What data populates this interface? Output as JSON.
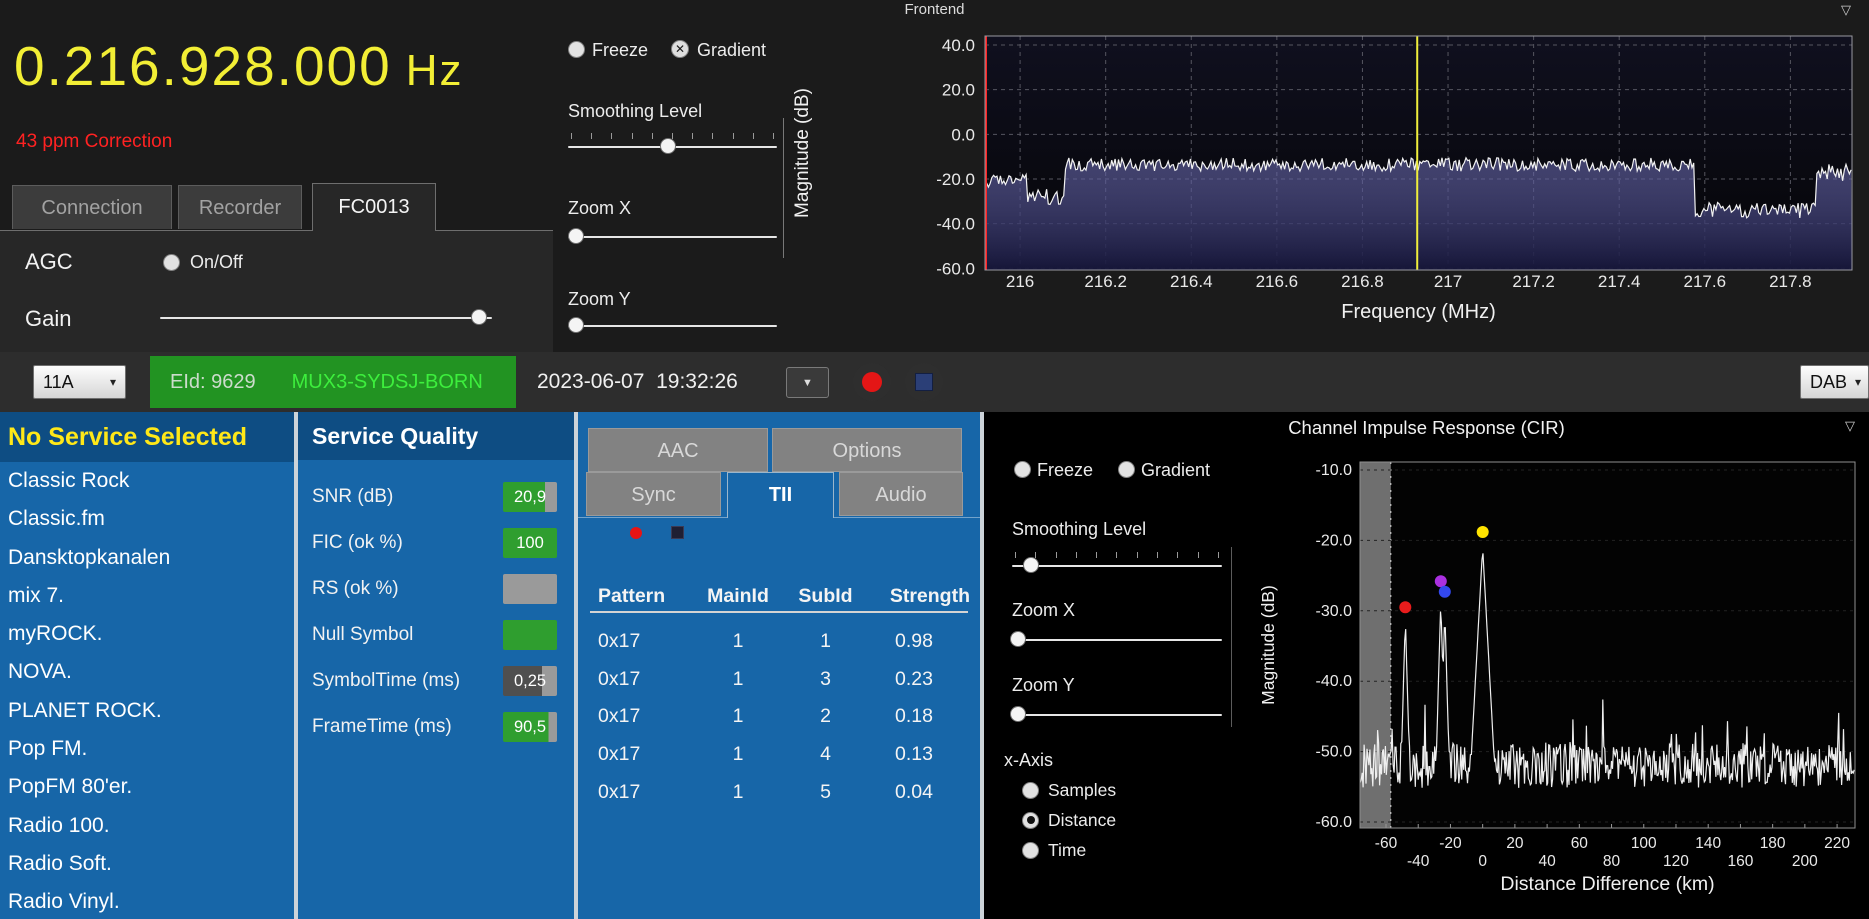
{
  "window": {
    "title": "Frontend"
  },
  "icons": {
    "collapse_triangle": "▽",
    "dropdown_arrow": "▼",
    "combo_arrow": "▾",
    "gradient_checked_x": "✕"
  },
  "frontend": {
    "frequency": "0.216.928.000",
    "frequency_unit": "Hz",
    "correction": "43 ppm Correction",
    "tabs": [
      {
        "label": "Connection",
        "active": false
      },
      {
        "label": "Recorder",
        "active": false
      },
      {
        "label": "FC0013",
        "active": true
      }
    ],
    "agc_label": "AGC",
    "agc_toggle": {
      "label": "On/Off",
      "checked": false
    },
    "gain_label": "Gain",
    "gain_slider_pct": 96
  },
  "spectrum_controls": {
    "freeze": {
      "label": "Freeze",
      "checked": false
    },
    "gradient": {
      "label": "Gradient",
      "checked": true
    },
    "smoothing": {
      "label": "Smoothing Level",
      "pct": 48
    },
    "zoom_x": {
      "label": "Zoom X",
      "pct": 4
    },
    "zoom_y": {
      "label": "Zoom Y",
      "pct": 4
    }
  },
  "toolbar": {
    "channel_select": "11A",
    "eid": "EId: 9629",
    "mux_name": "MUX3-SYDSJ-BORN",
    "datetime": "2023-06-07  19:32:26",
    "mode_select": "DAB"
  },
  "service_list": {
    "header": "No Service Selected",
    "services": [
      "Classic Rock",
      "Classic.fm",
      "Dansktopkanalen",
      "mix 7.",
      "myROCK.",
      "NOVA.",
      "PLANET ROCK.",
      "Pop FM.",
      "PopFM 80'er.",
      "Radio 100.",
      "Radio Soft.",
      "Radio Vinyl."
    ]
  },
  "service_quality": {
    "header": "Service Quality",
    "rows": [
      {
        "label": "SNR (dB)",
        "value": "20,9",
        "fill_color": "#2f9e2f",
        "fill_pct": 78
      },
      {
        "label": "FIC (ok %)",
        "value": "100",
        "fill_color": "#2f9e2f",
        "fill_pct": 100
      },
      {
        "label": "RS (ok %)",
        "value": "",
        "fill_color": "#2f9e2f",
        "fill_pct": 0
      },
      {
        "label": "Null Symbol",
        "value": "",
        "fill_color": "#2f9e2f",
        "fill_pct": 100
      },
      {
        "label": "SymbolTime (ms)",
        "value": "0,25",
        "fill_color": "#4f4f4f",
        "fill_pct": 72
      },
      {
        "label": "FrameTime (ms)",
        "value": "90,5",
        "fill_color": "#2f9e2f",
        "fill_pct": 84
      }
    ]
  },
  "tii_panel": {
    "tabs_row1": [
      {
        "label": "AAC",
        "active": false
      },
      {
        "label": "Options",
        "active": false
      }
    ],
    "tabs_row2": [
      {
        "label": "Sync",
        "active": false
      },
      {
        "label": "TII",
        "active": true
      },
      {
        "label": "Audio",
        "active": false
      }
    ],
    "table": {
      "headers": [
        "Pattern",
        "MainId",
        "SubId",
        "Strength"
      ],
      "rows": [
        [
          "0x17",
          "1",
          "1",
          "0.98"
        ],
        [
          "0x17",
          "1",
          "3",
          "0.23"
        ],
        [
          "0x17",
          "1",
          "2",
          "0.18"
        ],
        [
          "0x17",
          "1",
          "4",
          "0.13"
        ],
        [
          "0x17",
          "1",
          "5",
          "0.04"
        ]
      ]
    }
  },
  "cir_panel": {
    "title": "Channel Impulse Response (CIR)",
    "freeze": {
      "label": "Freeze",
      "checked": false
    },
    "gradient": {
      "label": "Gradient",
      "checked": false
    },
    "smoothing": {
      "label": "Smoothing Level",
      "pct": 9
    },
    "zoom_x": {
      "label": "Zoom X",
      "pct": 3
    },
    "zoom_y": {
      "label": "Zoom Y",
      "pct": 3
    },
    "xaxis_group": {
      "label": "x-Axis",
      "options": [
        {
          "label": "Samples",
          "selected": false
        },
        {
          "label": "Distance",
          "selected": true
        },
        {
          "label": "Time",
          "selected": false
        }
      ]
    }
  },
  "chart_data": [
    {
      "type": "line",
      "name": "frontend-spectrum",
      "ylabel": "Magnitude (dB)",
      "xlabel": "Frequency (MHz)",
      "ytick_labels": [
        "40.0",
        "20.0",
        "0.0",
        "-20.0",
        "-40.0",
        "-60.0"
      ],
      "xtick_labels": [
        "216",
        "216.2",
        "216.4",
        "216.6",
        "216.8",
        "217",
        "217.2",
        "217.4",
        "217.6",
        "217.8"
      ],
      "xlim": [
        215.918,
        217.944
      ],
      "ylim": [
        -60,
        40
      ],
      "tuned_marker_mhz": 216.928,
      "marker_color": "#f0ee3c",
      "left_edge_line_color": "#ff2222",
      "trace_segments": [
        {
          "from": 215.918,
          "to": 216.015,
          "base": -21,
          "amp": 3
        },
        {
          "from": 216.015,
          "to": 216.105,
          "base": -28,
          "amp": 3.5
        },
        {
          "from": 216.105,
          "to": 217.575,
          "base": -13.5,
          "amp": 3
        },
        {
          "from": 217.575,
          "to": 217.86,
          "base": -34,
          "amp": 3.5
        },
        {
          "from": 217.86,
          "to": 217.944,
          "base": -17,
          "amp": 4
        }
      ]
    },
    {
      "type": "line",
      "name": "channel-impulse-response",
      "ylabel": "Magnitude (dB)",
      "xlabel": "Distance Difference (km)",
      "ytick_labels": [
        "-10.0",
        "-20.0",
        "-30.0",
        "-40.0",
        "-50.0",
        "-60.0"
      ],
      "xtick_labels": [
        "-60",
        "-40",
        "-20",
        "0",
        "20",
        "40",
        "60",
        "80",
        "100",
        "120",
        "140",
        "160",
        "180",
        "200",
        "220"
      ],
      "xlim": [
        -76,
        231
      ],
      "ylim": [
        -60.8,
        -8.9
      ],
      "noise_floor_db": -52,
      "noise_amp_db": 3.2,
      "guard_band_end_km": -57,
      "peaks": [
        {
          "x_km": -48,
          "db": -31,
          "slope": 8
        },
        {
          "x_km": -26,
          "db": -28.5,
          "slope": 8
        },
        {
          "x_km": -23.5,
          "db": -30,
          "slope": 8
        },
        {
          "x_km": 0,
          "db": -21,
          "slope": 4.2
        }
      ],
      "dots": [
        {
          "x_km": -48,
          "db": -29.5,
          "color": "#e81c1c",
          "name": "red"
        },
        {
          "x_km": -26,
          "db": -25.8,
          "color": "#aa30e0",
          "name": "purple"
        },
        {
          "x_km": -23.5,
          "db": -27.3,
          "color": "#3348ee",
          "name": "blue"
        },
        {
          "x_km": 0,
          "db": -18.8,
          "color": "#ffe400",
          "name": "yellow"
        }
      ]
    }
  ]
}
